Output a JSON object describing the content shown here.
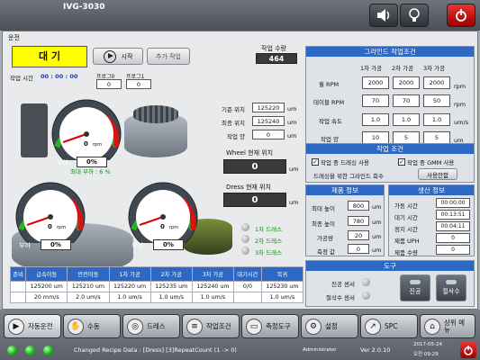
{
  "app": {
    "title": "IVG-3030"
  },
  "top_buttons": {
    "sound_icon": "speaker-icon",
    "light_icon": "bulb-icon",
    "power_icon": "power-icon"
  },
  "run": {
    "section_label": "운전",
    "state": "대 기",
    "start_label": "시작",
    "add_job_label": "추가 작업",
    "job_time_label": "작업 시간",
    "job_time": "00 : 00 : 00",
    "program0_label": "프로그0",
    "program1_label": "프로그1",
    "program0_value": "0",
    "program1_value": "0",
    "job_qty_label": "작업 수량",
    "job_qty": "464"
  },
  "gauges": {
    "main": {
      "rpm": "0",
      "unit": "rpm",
      "load_label": "부하",
      "load": "0%",
      "max_load_text": "최대 부하 : 6 %",
      "ticks": [
        "0",
        "1000",
        "2000",
        "3000",
        "4000"
      ]
    },
    "left": {
      "rpm": "0",
      "unit": "rpm",
      "load_label": "부하",
      "load": "0%",
      "ticks": [
        "0",
        "600",
        "1200",
        "1800",
        "2400"
      ]
    },
    "right": {
      "rpm": "0",
      "unit": "rpm",
      "load_label": "부하",
      "load": "0%",
      "ticks": [
        "0",
        "300",
        "600",
        "900",
        "1200"
      ]
    }
  },
  "positions": {
    "ref_label": "기준 위치",
    "ref_value": "125220",
    "final_label": "최종 위치",
    "final_value": "125240",
    "amount_label": "작업 양",
    "amount_value": "0",
    "unit": "um",
    "wheel_label": "Wheel 현재 위치",
    "wheel_value": "0",
    "dress_label": "Dress 현재 위치",
    "dress_value": "0"
  },
  "dress_steps": [
    "1차 드레스",
    "2차 드레스",
    "3차 드레스"
  ],
  "process_table": {
    "headers": [
      "준비",
      "급속이동",
      "안전이동",
      "1차 가공",
      "2차 가공",
      "3차 가공",
      "대기시간",
      "복귀"
    ],
    "row1": [
      "",
      "125200 um",
      "125210 um",
      "125220 um",
      "125235 um",
      "125240 um",
      "0/0",
      "125230 um"
    ],
    "row2": [
      "",
      "20 mm/s",
      "2.0 um/s",
      "1.0 um/s",
      "1.0 um/s",
      "1.0 um/s",
      "",
      "1.0 um/s"
    ]
  },
  "grind_cond": {
    "title": "그라인드 작업조건",
    "cols": [
      "1차 가공",
      "2차 가공",
      "3차 가공"
    ],
    "rows": [
      {
        "label": "휠 RPM",
        "values": [
          "2000",
          "2000",
          "2000"
        ],
        "unit": "rpm"
      },
      {
        "label": "테이블 RPM",
        "values": [
          "70",
          "70",
          "50"
        ],
        "unit": "rpm"
      },
      {
        "label": "작업 속도",
        "values": [
          "1.0",
          "1.0",
          "1.0"
        ],
        "unit": "um/s"
      },
      {
        "label": "작업 양",
        "values": [
          "10",
          "5",
          "5"
        ],
        "unit": "um"
      }
    ]
  },
  "work_cond": {
    "title": "작업 조건",
    "check1": "작업 중 드레싱 사용",
    "check2": "작업 중 GMM 사용",
    "count_label": "드레싱을 위한 그라인드 회수",
    "count_btn": "사용안함"
  },
  "product_info": {
    "title": "제품 정보",
    "rows": [
      {
        "label": "최대 높이",
        "value": "800",
        "unit": "um"
      },
      {
        "label": "최종 높이",
        "value": "780",
        "unit": "um"
      },
      {
        "label": "가공량",
        "value": "20",
        "unit": "um"
      },
      {
        "label": "측정 값",
        "value": "0",
        "unit": "um"
      }
    ]
  },
  "prod_info": {
    "title": "생산 정보",
    "rows": [
      {
        "label": "가동 시간",
        "value": "00:00:00"
      },
      {
        "label": "대기 시간",
        "value": "00:13:51"
      },
      {
        "label": "정지 시간",
        "value": "00:04:11"
      },
      {
        "label": "제품 UPH",
        "value": "0"
      },
      {
        "label": "제품 수량",
        "value": "0"
      }
    ]
  },
  "tools": {
    "title": "도구",
    "sensor1": "진공 센서",
    "sensor2": "절삭수 센서",
    "btn1": "진공",
    "btn2": "절삭수"
  },
  "nav": [
    "자동운전",
    "수동",
    "드레스",
    "작업조건",
    "측정도구",
    "설정",
    "SPC",
    "상위 메뉴"
  ],
  "status": {
    "message": "Changed Recipe Data : [Dress] [3]RepeatCount (1 -> 0)",
    "user": "Administrator",
    "version": "Ver 2.0.10",
    "date": "2017-05-24",
    "time": "오전 09:29"
  }
}
